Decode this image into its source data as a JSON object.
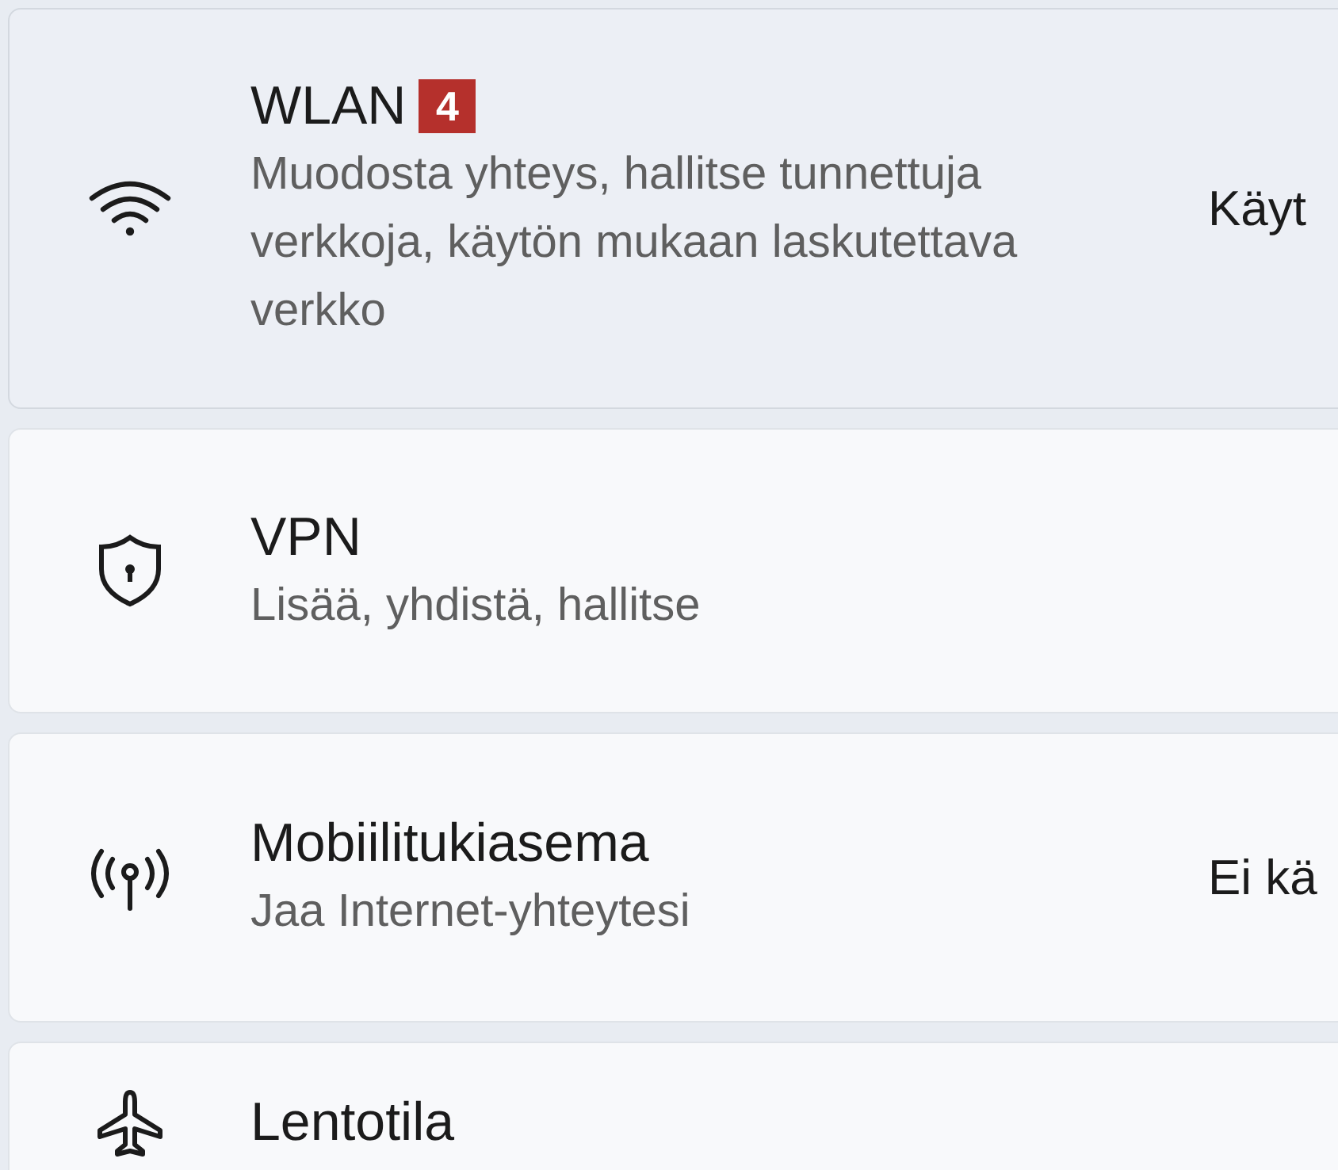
{
  "settings_items": [
    {
      "title": "WLAN",
      "badge": "4",
      "description": "Muodosta yhteys, hallitse tunnettuja verkkoja, käytön mukaan laskutettava verkko",
      "status": "Käyt",
      "selected": true
    },
    {
      "title": "VPN",
      "description": "Lisää, yhdistä, hallitse",
      "selected": false
    },
    {
      "title": "Mobiilitukiasema",
      "description": "Jaa Internet-yhteytesi",
      "status": "Ei kä",
      "selected": false
    },
    {
      "title": "Lentotila",
      "selected": false
    }
  ]
}
